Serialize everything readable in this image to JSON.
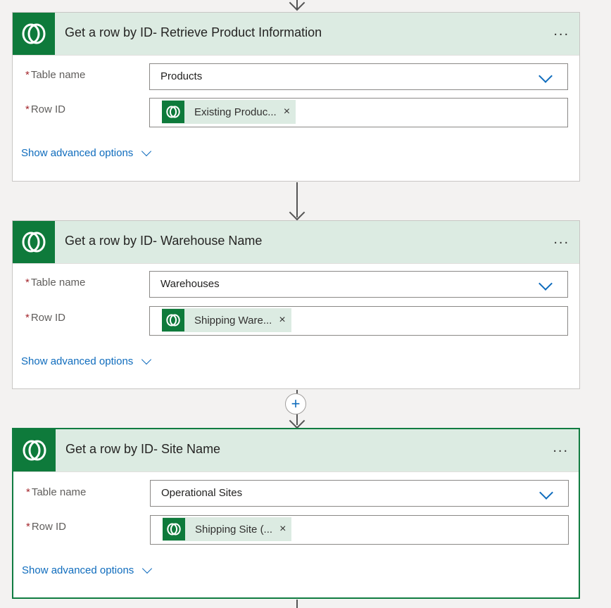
{
  "cards": [
    {
      "title": "Get a row by ID- Retrieve Product Information",
      "more": "...",
      "table_label": "Table name",
      "table_value": "Products",
      "row_label": "Row ID",
      "row_token": "Existing Produc...",
      "token_remove": "×",
      "advanced": "Show advanced options",
      "required": "*"
    },
    {
      "title": "Get a row by ID- Warehouse Name",
      "more": "...",
      "table_label": "Table name",
      "table_value": "Warehouses",
      "row_label": "Row ID",
      "row_token": "Shipping Ware...",
      "token_remove": "×",
      "advanced": "Show advanced options",
      "required": "*"
    },
    {
      "title": "Get a row by ID- Site Name",
      "more": "...",
      "table_label": "Table name",
      "table_value": "Operational Sites",
      "row_label": "Row ID",
      "row_token": "Shipping Site (...",
      "token_remove": "×",
      "advanced": "Show advanced options",
      "required": "*"
    }
  ],
  "insert_step": "+",
  "colors": {
    "dataverse_green": "#0e7a3b",
    "header_bg": "#dcebe2",
    "link_blue": "#0f6cbd",
    "selected_border": "#107c41"
  }
}
